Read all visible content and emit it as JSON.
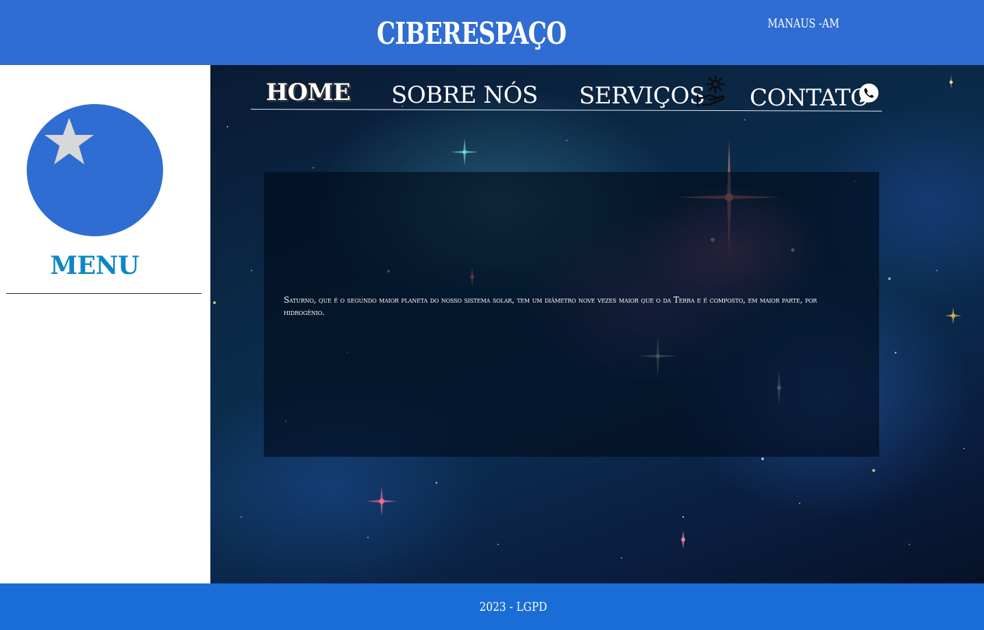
{
  "header": {
    "title": "CIBERESPAÇO",
    "location": "MANAUS -AM",
    "background_color": "#2f6dd3"
  },
  "sidebar": {
    "logo_icon": "star-icon",
    "logo_color": "#2f6dd3",
    "menu_title": "MENU",
    "menu_title_color": "#0e86c4"
  },
  "nav": {
    "items": [
      {
        "label": "HOME"
      },
      {
        "label": "SOBRE NÓS"
      },
      {
        "label": "SERVIÇOS",
        "icon": "hand-gear-icon"
      },
      {
        "label": "CONTATO",
        "icon": "whatsapp-icon"
      }
    ]
  },
  "main": {
    "background": "space-nebula",
    "content_text": "Saturno, que é o segundo maior planeta do nosso sistema solar, tem um diâmetro nove vezes maior que o da Terra e é composto, em maior parte, por hidrogênio."
  },
  "footer": {
    "text": "2023 - LGPD",
    "background_color": "#1a6dd6"
  }
}
